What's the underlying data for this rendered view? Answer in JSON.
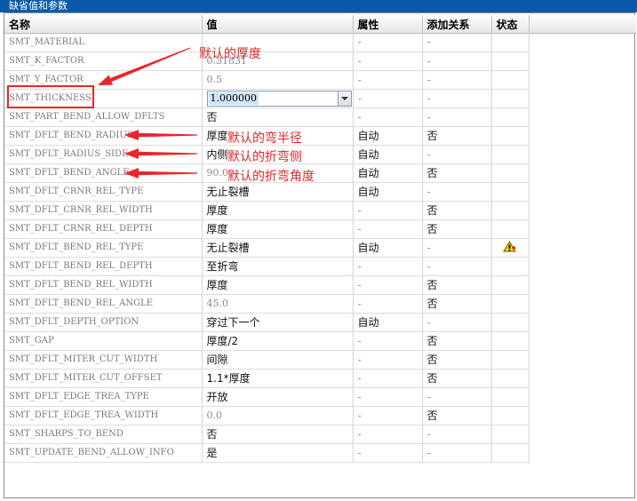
{
  "window": {
    "title": "缺省值和参数"
  },
  "columns": {
    "name": "名称",
    "value": "值",
    "attr": "属性",
    "rel": "添加关系",
    "status": "状态"
  },
  "rows": [
    {
      "name": "SMT_MATERIAL",
      "value": "",
      "attr": "-",
      "rel": "-"
    },
    {
      "name": "SMT_K_FACTOR",
      "value": "0.31831",
      "attr": "-",
      "rel": "-"
    },
    {
      "name": "SMT_Y_FACTOR",
      "value": "0.5",
      "attr": "-",
      "rel": "-"
    },
    {
      "name": "SMT_THICKNESS",
      "value": "1.000000",
      "attr": "-",
      "rel": "-"
    },
    {
      "name": "SMT_PART_BEND_ALLOW_DFLTS",
      "value": "否",
      "attr": "-",
      "rel": "-"
    },
    {
      "name": "SMT_DFLT_BEND_RADIUS",
      "value": "厚度",
      "attr": "自动",
      "rel": "否"
    },
    {
      "name": "SMT_DFLT_RADIUS_SIDE",
      "value": "内侧",
      "attr": "自动",
      "rel": "-"
    },
    {
      "name": "SMT_DFLT_BEND_ANGLE",
      "value": "90.0",
      "attr": "自动",
      "rel": "否"
    },
    {
      "name": "SMT_DFLT_CRNR_REL_TYPE",
      "value": "无止裂槽",
      "attr": "自动",
      "rel": "-"
    },
    {
      "name": "SMT_DFLT_CRNR_REL_WIDTH",
      "value": "厚度",
      "attr": "-",
      "rel": "否"
    },
    {
      "name": "SMT_DFLT_CRNR_REL_DEPTH",
      "value": "厚度",
      "attr": "-",
      "rel": "否"
    },
    {
      "name": "SMT_DFLT_BEND_REL_TYPE",
      "value": "无止裂槽",
      "attr": "自动",
      "rel": "-",
      "status": "warning"
    },
    {
      "name": "SMT_DFLT_BEND_REL_DEPTH",
      "value": "至折弯",
      "attr": "-",
      "rel": "-"
    },
    {
      "name": "SMT_DFLT_BEND_REL_WIDTH",
      "value": "厚度",
      "attr": "-",
      "rel": "否"
    },
    {
      "name": "SMT_DFLT_BEND_REL_ANGLE",
      "value": "45.0",
      "attr": "-",
      "rel": "否"
    },
    {
      "name": "SMT_DFLT_DEPTH_OPTION",
      "value": "穿过下一个",
      "attr": "自动",
      "rel": "-"
    },
    {
      "name": "SMT_GAP",
      "value": "厚度/2",
      "attr": "-",
      "rel": "否"
    },
    {
      "name": "SMT_DFLT_MITER_CUT_WIDTH",
      "value": "间隙",
      "attr": "-",
      "rel": "否"
    },
    {
      "name": "SMT_DFLT_MITER_CUT_OFFSET",
      "value": "1.1*厚度",
      "attr": "-",
      "rel": "否"
    },
    {
      "name": "SMT_DFLT_EDGE_TREA_TYPE",
      "value": "开放",
      "attr": "-",
      "rel": "-"
    },
    {
      "name": "SMT_DFLT_EDGE_TREA_WIDTH",
      "value": "0.0",
      "attr": "-",
      "rel": "否"
    },
    {
      "name": "SMT_SHARPS_TO_BEND",
      "value": "否",
      "attr": "-",
      "rel": "-"
    },
    {
      "name": "SMT_UPDATE_BEND_ALLOW_INFO",
      "value": "是",
      "attr": "-",
      "rel": "-"
    }
  ],
  "annotations": {
    "thickness": "默认的厚度",
    "bend_radius": "默认的弯半径",
    "radius_side": "默认的折弯侧",
    "bend_angle": "默认的折弯角度"
  },
  "colors": {
    "annotation": "#e8262a",
    "titlebar": "#0b5aa8"
  }
}
